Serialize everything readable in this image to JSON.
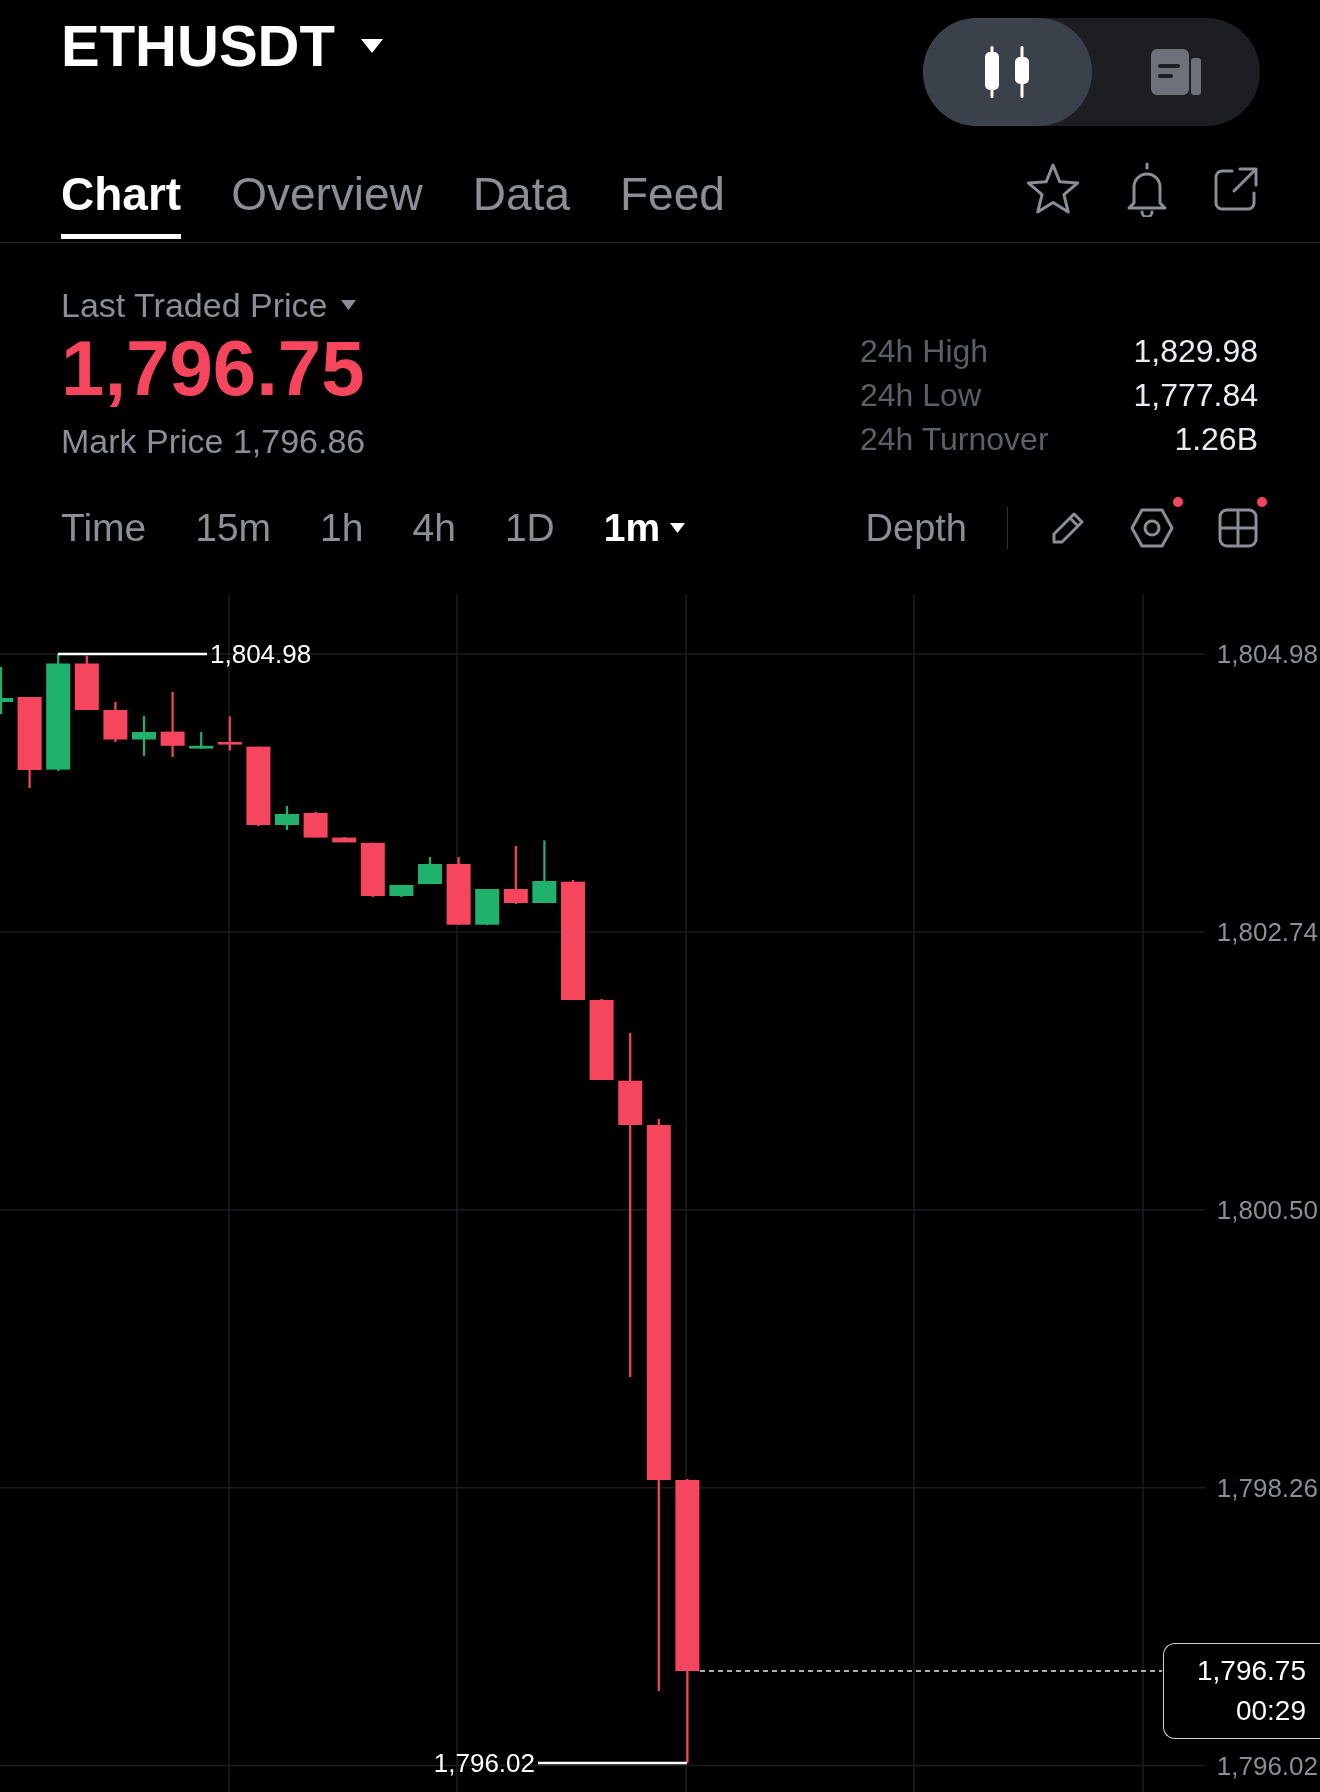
{
  "header": {
    "symbol": "ETHUSDT",
    "view_toggle": [
      {
        "selected": true
      },
      {
        "selected": false
      }
    ]
  },
  "tabs": [
    {
      "label": "Chart",
      "selected": true
    },
    {
      "label": "Overview",
      "selected": false
    },
    {
      "label": "Data",
      "selected": false
    },
    {
      "label": "Feed",
      "selected": false
    }
  ],
  "price": {
    "label": "Last Traded Price",
    "last": "1,796.75",
    "falling": true,
    "mark": "Mark Price 1,796.86"
  },
  "stats": [
    {
      "label": "24h High",
      "value": "1,829.98"
    },
    {
      "label": "24h Low",
      "value": "1,777.84"
    },
    {
      "label": "24h Turnover",
      "value": "1.26B"
    }
  ],
  "timeframes": [
    {
      "label": "Time",
      "selected": false,
      "dropdown": false
    },
    {
      "label": "15m",
      "selected": false,
      "dropdown": false
    },
    {
      "label": "1h",
      "selected": false,
      "dropdown": false
    },
    {
      "label": "4h",
      "selected": false,
      "dropdown": false
    },
    {
      "label": "1D",
      "selected": false,
      "dropdown": false
    },
    {
      "label": "1m",
      "selected": true,
      "dropdown": true
    }
  ],
  "chart_tools": {
    "depth": "Depth",
    "tools": [
      {
        "badge": false
      },
      {
        "badge": true
      },
      {
        "badge": true
      }
    ]
  },
  "chart": {
    "y_axis": [
      "1,804.98",
      "1,802.74",
      "1,800.50",
      "1,798.26",
      "1,796.02"
    ],
    "high_label": "1,804.98",
    "low_label": "1,796.02",
    "last_price": "1,796.75",
    "countdown": "00:29"
  }
}
